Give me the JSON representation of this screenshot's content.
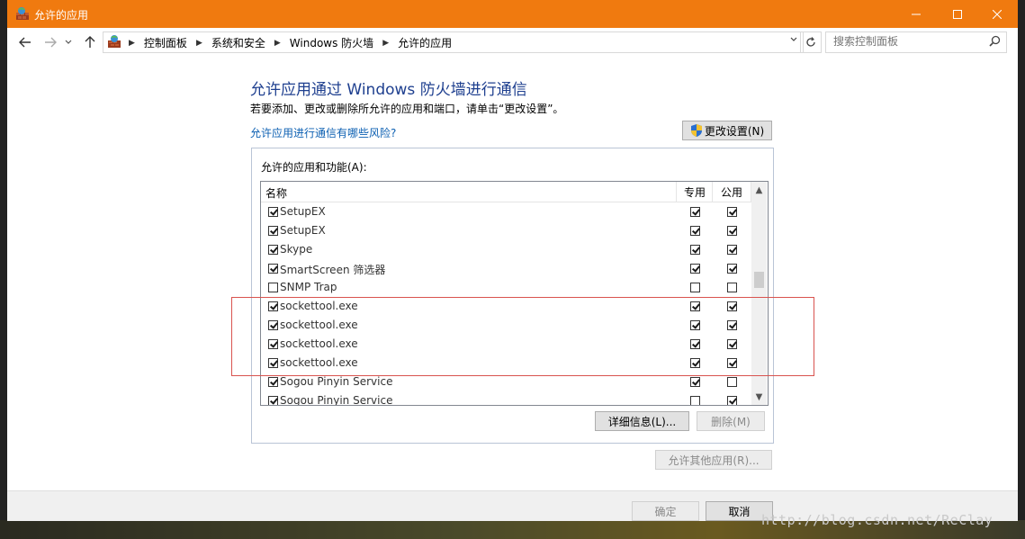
{
  "window": {
    "title": "允许的应用",
    "accent_color": "#f07a0f"
  },
  "nav": {
    "breadcrumbs": [
      "控制面板",
      "系统和安全",
      "Windows 防火墙",
      "允许的应用"
    ],
    "search_placeholder": "搜索控制面板"
  },
  "main": {
    "heading": "允许应用通过 Windows 防火墙进行通信",
    "description": "若要添加、更改或删除所允许的应用和端口，请单击“更改设置”。",
    "risk_link": "允许应用进行通信有哪些风险?",
    "change_settings_label": "更改设置(N)",
    "group_label": "允许的应用和功能(A):",
    "columns": {
      "name": "名称",
      "private": "专用",
      "public": "公用"
    },
    "rows": [
      {
        "name": "SetupEX",
        "enabled": true,
        "private": true,
        "public": true
      },
      {
        "name": "SetupEX",
        "enabled": true,
        "private": true,
        "public": true
      },
      {
        "name": "Skype",
        "enabled": true,
        "private": true,
        "public": true
      },
      {
        "name": "SmartScreen 筛选器",
        "enabled": true,
        "private": true,
        "public": true
      },
      {
        "name": "SNMP Trap",
        "enabled": false,
        "private": false,
        "public": false
      },
      {
        "name": "sockettool.exe",
        "enabled": true,
        "private": true,
        "public": true
      },
      {
        "name": "sockettool.exe",
        "enabled": true,
        "private": true,
        "public": true
      },
      {
        "name": "sockettool.exe",
        "enabled": true,
        "private": true,
        "public": true
      },
      {
        "name": "sockettool.exe",
        "enabled": true,
        "private": true,
        "public": true
      },
      {
        "name": "Sogou Pinyin Service",
        "enabled": true,
        "private": true,
        "public": false
      },
      {
        "name": "Sogou Pinyin Service",
        "enabled": true,
        "private": false,
        "public": true
      }
    ],
    "details_label": "详细信息(L)...",
    "remove_label": "删除(M)",
    "allow_other_label": "允许其他应用(R)..."
  },
  "footer": {
    "ok_label": "确定",
    "cancel_label": "取消"
  },
  "watermark": "http://blog.csdn.net/ReClay"
}
